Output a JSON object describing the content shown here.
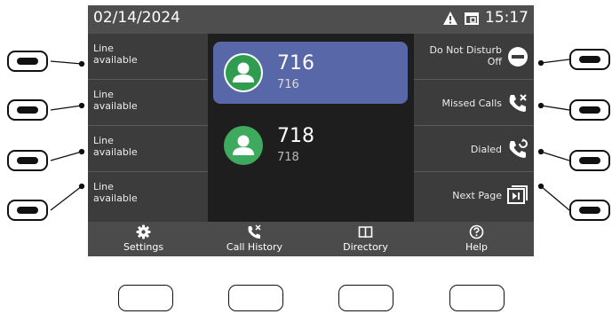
{
  "status_bar": {
    "date": "02/14/2024",
    "time": "15:17",
    "icons": [
      "warning-icon",
      "window-icon"
    ]
  },
  "line_keys": [
    {
      "line1": "Line",
      "line2": "available"
    },
    {
      "line1": "Line",
      "line2": "available"
    },
    {
      "line1": "Line",
      "line2": "available"
    },
    {
      "line1": "Line",
      "line2": "available"
    }
  ],
  "contacts": [
    {
      "name": "716",
      "number": "716",
      "active": true
    },
    {
      "name": "718",
      "number": "718",
      "active": false
    }
  ],
  "function_keys": [
    {
      "line1": "Do Not Disturb",
      "line2": "Off",
      "icon": "do-not-disturb-icon"
    },
    {
      "line1": "Missed Calls",
      "line2": "",
      "icon": "missed-call-icon"
    },
    {
      "line1": "Dialed",
      "line2": "",
      "icon": "dialed-call-icon"
    },
    {
      "line1": "Next Page",
      "line2": "",
      "icon": "next-page-icon"
    }
  ],
  "soft_keys": [
    {
      "label": "Settings",
      "icon": "gear-icon"
    },
    {
      "label": "Call History",
      "icon": "call-history-icon"
    },
    {
      "label": "Directory",
      "icon": "book-icon"
    },
    {
      "label": "Help",
      "icon": "help-icon"
    }
  ],
  "colors": {
    "active_contact": "#5867a8",
    "avatar_green": "#3eaa5e",
    "status_bar": "#4e4e4e",
    "panel": "#3c3c3c"
  }
}
